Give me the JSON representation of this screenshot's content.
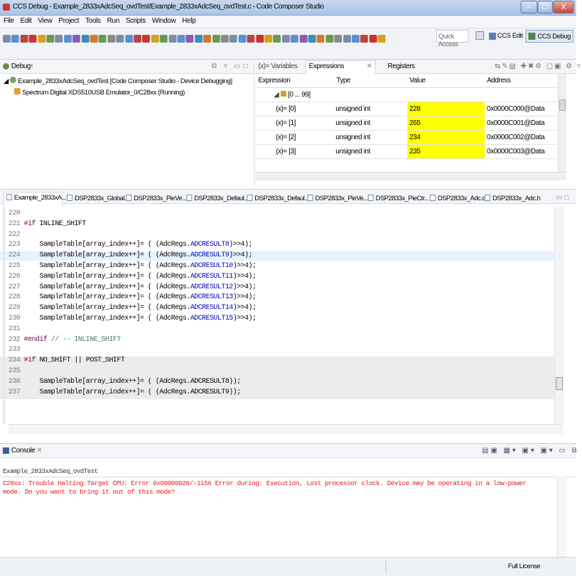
{
  "window": {
    "title": "CCS Debug - Example_2833xAdcSeq_ovdTest/Example_2833xAdcSeq_ovdTest.c - Code Composer Studio",
    "minimize": "–",
    "maximize": "☐",
    "close": "X"
  },
  "menu": [
    "File",
    "Edit",
    "View",
    "Project",
    "Tools",
    "Run",
    "Scripts",
    "Window",
    "Help"
  ],
  "toolbar": {
    "quick_access_placeholder": "Quick Access",
    "perspective_edit": "CCS Edit",
    "perspective_debug": "CCS Debug"
  },
  "debug": {
    "tab_label": "Debug",
    "tree": [
      {
        "label": "Example_2833xAdcSeq_ovdTest [Code Composer Studio - Device Debugging]"
      },
      {
        "label": "Spectrum Digital XDS510USB Emulator_0/C28xx (Running)"
      }
    ]
  },
  "expressions": {
    "tabs": [
      "(x)= Variables",
      "Expressions",
      "Registers"
    ],
    "columns": [
      "Expression",
      "Type",
      "Value",
      "Address"
    ],
    "group": "[0 ... 99]",
    "rows": [
      {
        "expr": "[0]",
        "type": "unsigned int",
        "value": "228",
        "address": "0x0000C000@Data"
      },
      {
        "expr": "[1]",
        "type": "unsigned int",
        "value": "265",
        "address": "0x0000C001@Data"
      },
      {
        "expr": "[2]",
        "type": "unsigned int",
        "value": "234",
        "address": "0x0000C002@Data"
      },
      {
        "expr": "[3]",
        "type": "unsigned int",
        "value": "235",
        "address": "0x0000C003@Data"
      }
    ],
    "value_highlight": "#ffff00"
  },
  "editor": {
    "tabs": [
      "Example_2833xA...",
      "DSP2833x_Global...",
      "DSP2833x_PieVe...",
      "DSP2833x_Defaul...",
      "DSP2833x_Defaul...",
      "DSP2833x_PieVe...",
      "DSP2833x_PieCtr...",
      "DSP2833x_Adc.c",
      "DSP2833x_Adc.h"
    ],
    "lines": [
      {
        "n": "220",
        "pre": "",
        "kw": "",
        "rest": ""
      },
      {
        "n": "221",
        "pre": "",
        "kw": "#if",
        "rest": " INLINE_SHIFT"
      },
      {
        "n": "222",
        "pre": "",
        "kw": "",
        "rest": ""
      },
      {
        "n": "223",
        "pre": "    SampleTable[array_index++]= ( (AdcRegs.",
        "kw": "",
        "rest": "",
        "f": "ADCRESULT8",
        "post": ")>>4);"
      },
      {
        "n": "224",
        "pre": "    SampleTable[array_index++]= ( (AdcRegs.",
        "kw": "",
        "rest": "",
        "f": "ADCRESULT9",
        "post": ")>>4);",
        "hl": true
      },
      {
        "n": "225",
        "pre": "    SampleTable[array_index++]= ( (AdcRegs.",
        "kw": "",
        "rest": "",
        "f": "ADCRESULT10",
        "post": ")>>4);"
      },
      {
        "n": "226",
        "pre": "    SampleTable[array_index++]= ( (AdcRegs.",
        "kw": "",
        "rest": "",
        "f": "ADCRESULT11",
        "post": ")>>4);"
      },
      {
        "n": "227",
        "pre": "    SampleTable[array_index++]= ( (AdcRegs.",
        "kw": "",
        "rest": "",
        "f": "ADCRESULT12",
        "post": ")>>4);"
      },
      {
        "n": "228",
        "pre": "    SampleTable[array_index++]= ( (AdcRegs.",
        "kw": "",
        "rest": "",
        "f": "ADCRESULT13",
        "post": ")>>4);"
      },
      {
        "n": "229",
        "pre": "    SampleTable[array_index++]= ( (AdcRegs.",
        "kw": "",
        "rest": "",
        "f": "ADCRESULT14",
        "post": ")>>4);"
      },
      {
        "n": "230",
        "pre": "    SampleTable[array_index++]= ( (AdcRegs.",
        "kw": "",
        "rest": "",
        "f": "ADCRESULT15",
        "post": ")>>4);"
      },
      {
        "n": "231",
        "pre": "",
        "kw": "",
        "rest": ""
      },
      {
        "n": "232",
        "pre": "",
        "kw": "#endif",
        "rest": " // -- INLINE_SHIFT",
        "cm": true
      },
      {
        "n": "233",
        "pre": "",
        "kw": "",
        "rest": ""
      },
      {
        "n": "234",
        "pre": "",
        "kw": "#if",
        "rest": " NO_SHIFT || POST_SHIFT",
        "gray": true
      },
      {
        "n": "235",
        "pre": "",
        "kw": "",
        "rest": "",
        "gray": true
      },
      {
        "n": "236",
        "pre": "    SampleTable[array_index++]= ( (AdcRegs.ADCRESULT8));",
        "kw": "",
        "rest": "",
        "gray": true
      },
      {
        "n": "237",
        "pre": "    SampleTable[array_index++]= ( (AdcRegs.ADCRESULT9));",
        "kw": "",
        "rest": "",
        "gray": true
      }
    ]
  },
  "console": {
    "tab_label": "Console",
    "name": "Example_2833xAdcSeq_ovdTest",
    "message": "C28xx: Trouble Halting Target CPU: Error 0x00000020/-1156 Error during: Execution,  Lost processor clock. Device may be operating in a low-power mode.  Do you want to bring it out of this mode?",
    "error_color": "#e02020"
  },
  "status": {
    "license": "Full License"
  }
}
